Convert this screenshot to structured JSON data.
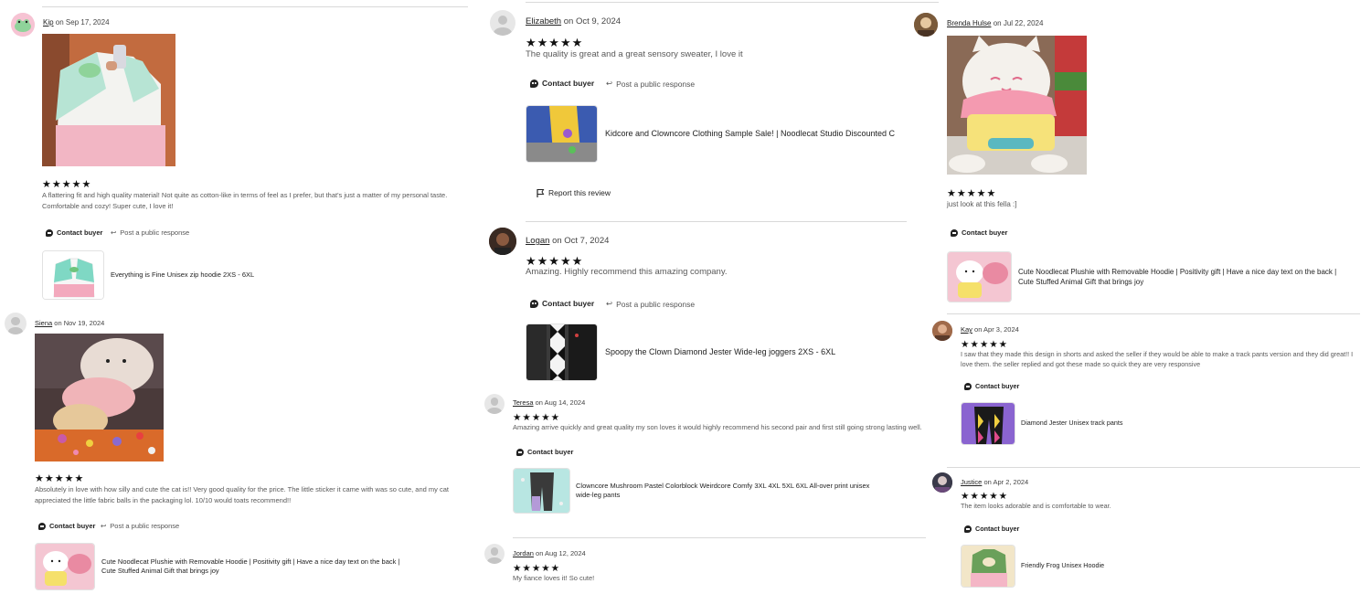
{
  "actions": {
    "contact": "Contact buyer",
    "public": "Post a public response",
    "report": "Report this review"
  },
  "reviews": [
    {
      "name": "Kip",
      "date": "on Sep 17, 2024",
      "stars": "★★★★★",
      "text": "A flattering fit and high quality material! Not quite as cotton-like in terms of feel as I prefer, but that's just a matter of my personal taste. Comfortable and cozy! Super cute, I love it!",
      "product": "Everything is Fine Unisex zip hoodie 2XS - 6XL"
    },
    {
      "name": "Siena",
      "date": "on Nov 19, 2024",
      "stars": "★★★★★",
      "text": "Absolutely in love with how silly and cute the cat is!! Very good quality for the price. The little sticker it came with was so cute, and my cat appreciated the little fabric balls in the packaging lol. 10/10 would toats recommend!!",
      "product": "Cute Noodlecat Plushie with Removable Hoodie | Positivity gift | Have a nice day text on the back | Cute Stuffed Animal Gift that brings joy"
    },
    {
      "name": "Elizabeth",
      "date": "on Oct 9, 2024",
      "stars": "★★★★★",
      "text": "The quality is great and a great sensory sweater, I love it",
      "product": "Kidcore and Clowncore Clothing Sample Sale! | Noodlecat Studio Discounted C"
    },
    {
      "name": "Logan",
      "date": "on Oct 7, 2024",
      "stars": "★★★★★",
      "text": "Amazing. Highly recommend this amazing company.",
      "product": "Spoopy the Clown Diamond Jester Wide-leg joggers 2XS - 6XL"
    },
    {
      "name": "Teresa",
      "date": "on Aug 14, 2024",
      "stars": "★★★★★",
      "text": "Amazing arrive quickly and great quality my son loves it would highly recommend his second pair and first still going strong lasting well.",
      "product": "Clowncore Mushroom Pastel Colorblock Weirdcore Comfy 3XL 4XL 5XL 6XL All-over print unisex wide-leg pants"
    },
    {
      "name": "Jordan",
      "date": "on Aug 12, 2024",
      "stars": "★★★★★",
      "text": "My fiance loves it! So cute!"
    },
    {
      "name": "Brenda Hulse",
      "date": "on Jul 22, 2024",
      "stars": "★★★★★",
      "text": "just look at this fella :]",
      "product": "Cute Noodlecat Plushie with Removable Hoodie | Positivity gift | Have a nice day text on the back | Cute Stuffed Animal Gift that brings joy"
    },
    {
      "name": "Kay",
      "date": "on Apr 3, 2024",
      "stars": "★★★★★",
      "text": "I saw that they made this design in shorts and asked the seller if they would be able to make a track pants version and they did great!! I love them. the seller replied and got these made so quick they are very responsive",
      "product": "Diamond Jester Unisex track pants"
    },
    {
      "name": "Justice",
      "date": "on Apr 2, 2024",
      "stars": "★★★★★",
      "text": "The item looks adorable and is comfortable to wear.",
      "product": "Friendly Frog Unisex Hoodie"
    }
  ]
}
